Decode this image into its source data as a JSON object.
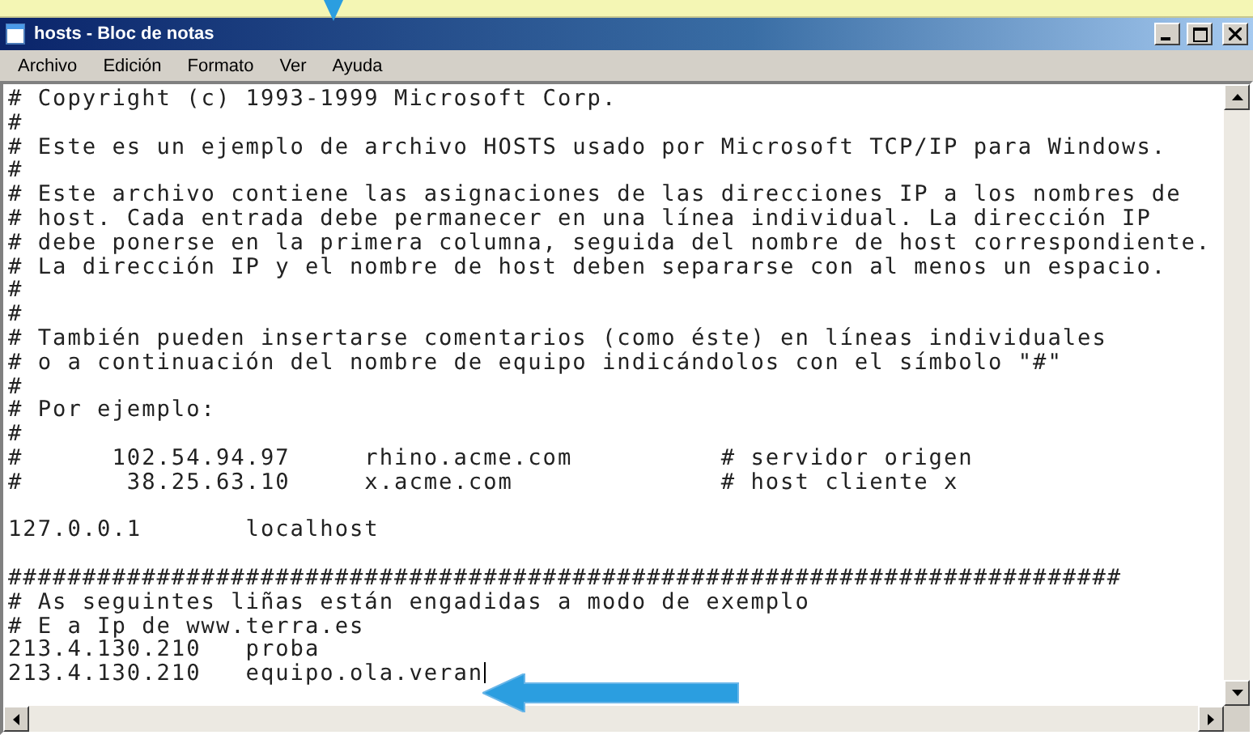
{
  "window": {
    "title": "hosts - Bloc de notas",
    "controls": [
      {
        "kind": "minimize"
      },
      {
        "kind": "maximize"
      },
      {
        "kind": "close"
      }
    ]
  },
  "menu": [
    {
      "label": "Archivo"
    },
    {
      "label": "Edición"
    },
    {
      "label": "Formato"
    },
    {
      "label": "Ver"
    },
    {
      "label": "Ayuda"
    }
  ],
  "editor": {
    "lines": [
      {
        "kind": "text",
        "text": "# Copyright (c) 1993-1999 Microsoft Corp.",
        "caret": false
      },
      {
        "kind": "text",
        "text": "#",
        "caret": false
      },
      {
        "kind": "text",
        "text": "# Este es un ejemplo de archivo HOSTS usado por Microsoft TCP/IP para Windows.",
        "caret": false
      },
      {
        "kind": "text",
        "text": "#",
        "caret": false
      },
      {
        "kind": "text",
        "text": "# Este archivo contiene las asignaciones de las direcciones IP a los nombres de",
        "caret": false
      },
      {
        "kind": "text",
        "text": "# host. Cada entrada debe permanecer en una línea individual. La dirección IP",
        "caret": false
      },
      {
        "kind": "text",
        "text": "# debe ponerse en la primera columna, seguida del nombre de host correspondiente.",
        "caret": false
      },
      {
        "kind": "text",
        "text": "# La dirección IP y el nombre de host deben separarse con al menos un espacio.",
        "caret": false
      },
      {
        "kind": "text",
        "text": "#",
        "caret": false
      },
      {
        "kind": "text",
        "text": "#",
        "caret": false
      },
      {
        "kind": "text",
        "text": "# También pueden insertarse comentarios (como éste) en líneas individuales",
        "caret": false
      },
      {
        "kind": "text",
        "text": "# o a continuación del nombre de equipo indicándolos con el símbolo \"#\"",
        "caret": false
      },
      {
        "kind": "text",
        "text": "#",
        "caret": false
      },
      {
        "kind": "text",
        "text": "# Por ejemplo:",
        "caret": false
      },
      {
        "kind": "text",
        "text": "#",
        "caret": false
      },
      {
        "kind": "text",
        "text": "#      102.54.94.97     rhino.acme.com          # servidor origen",
        "caret": false
      },
      {
        "kind": "text",
        "text": "#       38.25.63.10     x.acme.com              # host cliente x",
        "caret": false
      },
      {
        "kind": "blank"
      },
      {
        "kind": "text",
        "text": "127.0.0.1       localhost",
        "caret": false
      },
      {
        "kind": "blank"
      },
      {
        "kind": "text",
        "text": "###########################################################################",
        "caret": false
      },
      {
        "kind": "text",
        "text": "# As seguintes liñas están engadidas a modo de exemplo",
        "caret": false
      },
      {
        "kind": "text",
        "text": "# E a Ip de www.terra.es",
        "caret": false
      },
      {
        "kind": "text",
        "text": "213.4.130.210   proba",
        "caret": false
      },
      {
        "kind": "text",
        "text": "213.4.130.210   equipo.ola.veran",
        "caret": true
      }
    ]
  }
}
